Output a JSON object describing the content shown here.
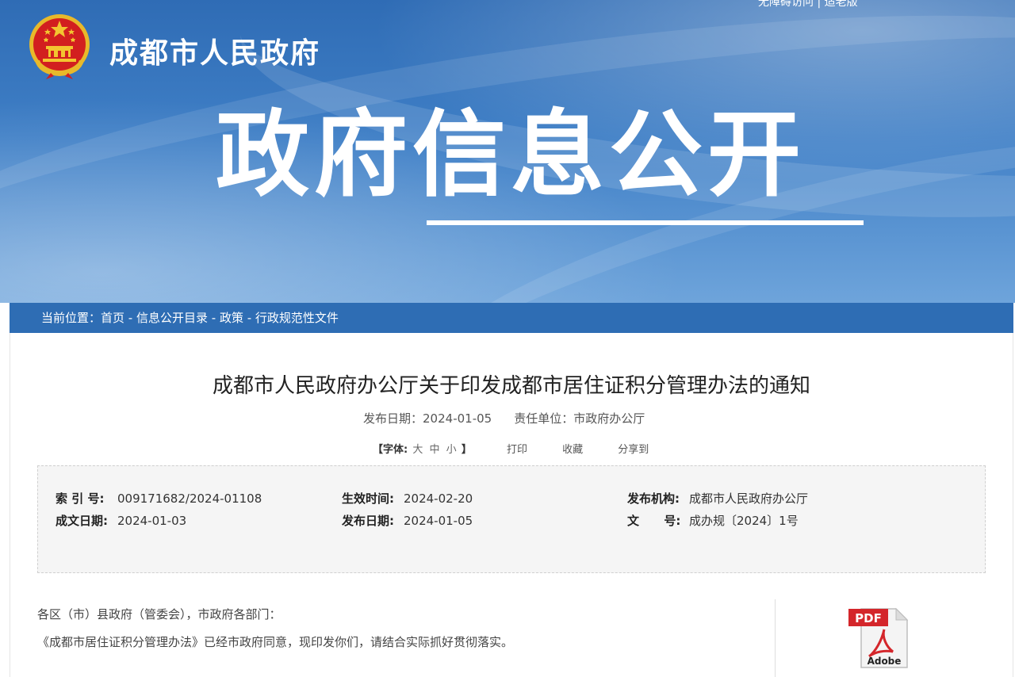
{
  "header": {
    "top_links": "无障碍访问 | 适老版",
    "site_title": "成都市人民政府",
    "big_title": "政府信息公开"
  },
  "breadcrumb": {
    "prefix": "当前位置：",
    "items": [
      "首页",
      "信息公开目录",
      "政策",
      "行政规范性文件"
    ],
    "separator": " - "
  },
  "document": {
    "title": "成都市人民政府办公厅关于印发成都市居住证积分管理办法的通知",
    "publish_label": "发布日期：",
    "publish_date": "2024-01-05",
    "unit_label": "责任单位：",
    "unit": "市政府办公厅"
  },
  "tools": {
    "font_label": "【字体:",
    "font_large": "大",
    "font_medium": "中",
    "font_small": "小",
    "font_close": "】",
    "print": "打印",
    "favorite": "收藏",
    "share": "分享到"
  },
  "info": {
    "index_label": "索 引 号:",
    "index_value": "009171682/2024-01108",
    "effective_label": "生效时间:",
    "effective_value": "2024-02-20",
    "agency_label": "发布机构:",
    "agency_value": "成都市人民政府办公厅",
    "written_label": "成文日期:",
    "written_value": "2024-01-03",
    "published_label": "发布日期:",
    "published_value": "2024-01-05",
    "docno_label": "文      号:",
    "docno_value": "成办规〔2024〕1号"
  },
  "body": {
    "line1": "各区（市）县政府（管委会），市政府各部门：",
    "line2": "《成都市居住证积分管理办法》已经市政府同意，现印发你们，请结合实际抓好贯彻落实。"
  },
  "attachment": {
    "pdf_label": "PDF",
    "brand": "Adobe"
  },
  "colors": {
    "brand_blue": "#2e6db4",
    "emblem_red": "#d21f1f",
    "emblem_gold": "#f3c530"
  }
}
